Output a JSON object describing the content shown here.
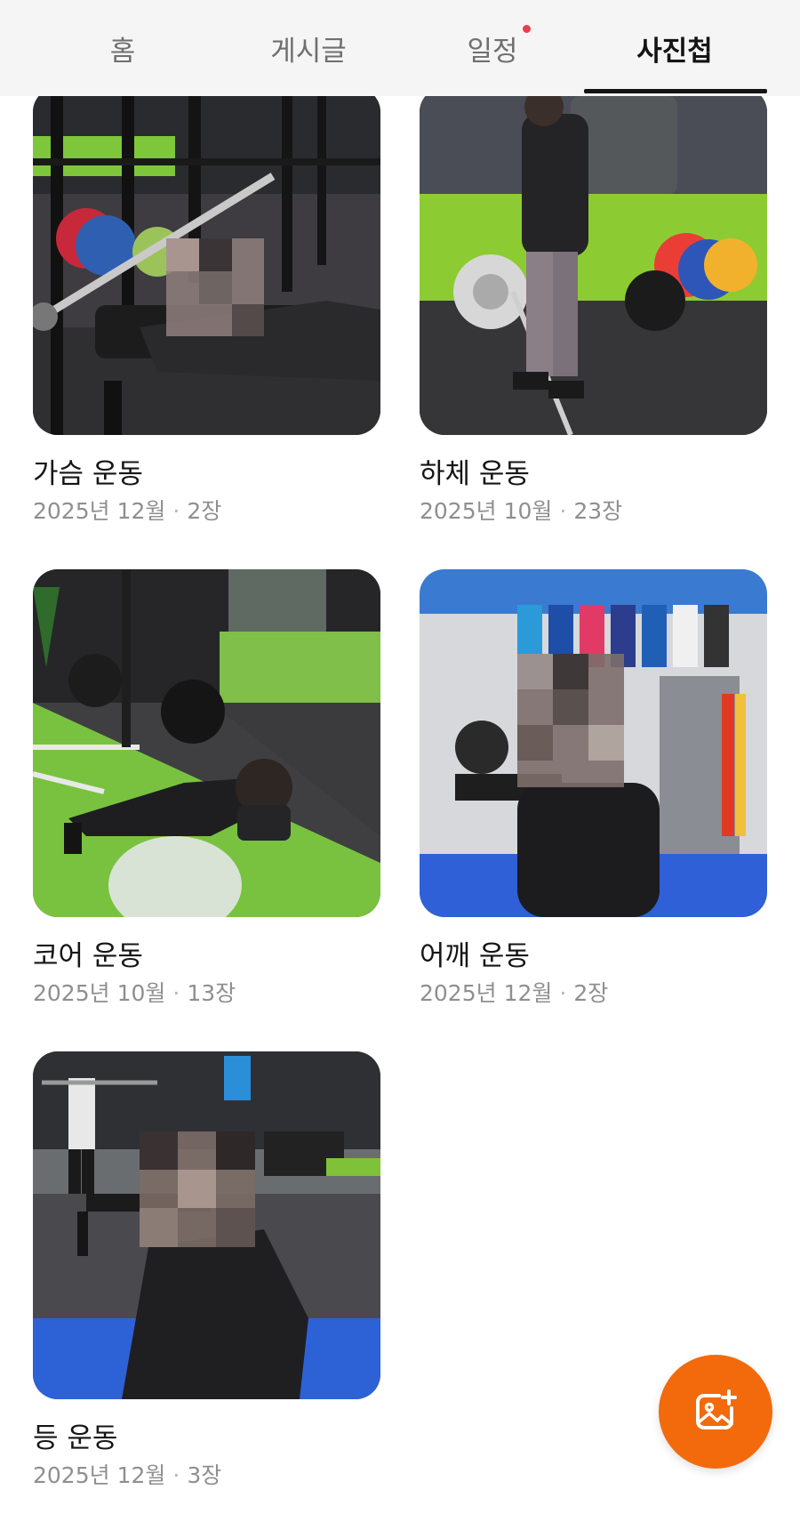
{
  "tabs": [
    {
      "label": "홈",
      "active": false,
      "has_dot": false
    },
    {
      "label": "게시글",
      "active": false,
      "has_dot": false
    },
    {
      "label": "일정",
      "active": false,
      "has_dot": true
    },
    {
      "label": "사진첩",
      "active": true,
      "has_dot": false
    }
  ],
  "albums": [
    {
      "title": "가슴 운동",
      "date": "2025년 12월",
      "count": "2장"
    },
    {
      "title": "하체 운동",
      "date": "2025년 10월",
      "count": "23장"
    },
    {
      "title": "코어 운동",
      "date": "2025년 10월",
      "count": "13장"
    },
    {
      "title": "어깨 운동",
      "date": "2025년 12월",
      "count": "2장"
    },
    {
      "title": "등 운동",
      "date": "2025년 12월",
      "count": "3장"
    }
  ],
  "meta_separator": "·",
  "fab": {
    "icon": "add-photo-icon"
  },
  "colors": {
    "accent": "#f26a0c",
    "notification_dot": "#ef3b4a",
    "tab_active": "#141414",
    "tab_inactive": "#6f6f6f"
  }
}
